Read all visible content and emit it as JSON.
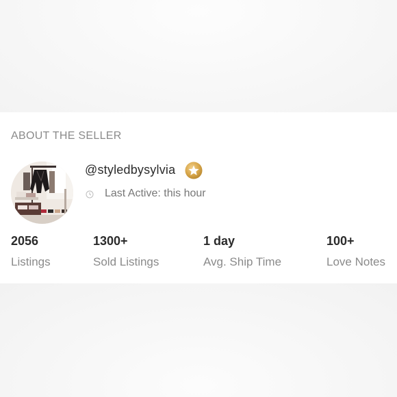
{
  "seller": {
    "section_title": "ABOUT THE SELLER",
    "username": "@styledbysylvia",
    "badge_icon": "star-badge-icon",
    "last_active": "Last Active: this hour",
    "clock_icon": "clock-icon",
    "avatar_description_icon": "closet-photo"
  },
  "stats": [
    {
      "value": "2056",
      "label": "Listings"
    },
    {
      "value": "1300+",
      "label": "Sold Listings"
    },
    {
      "value": "1 day",
      "label": "Avg. Ship Time"
    },
    {
      "value": "100+",
      "label": "Love Notes"
    }
  ],
  "colors": {
    "badge_gold": "#d7a64a",
    "text_primary": "#2b2b2b",
    "text_muted": "#8a8a8a"
  }
}
